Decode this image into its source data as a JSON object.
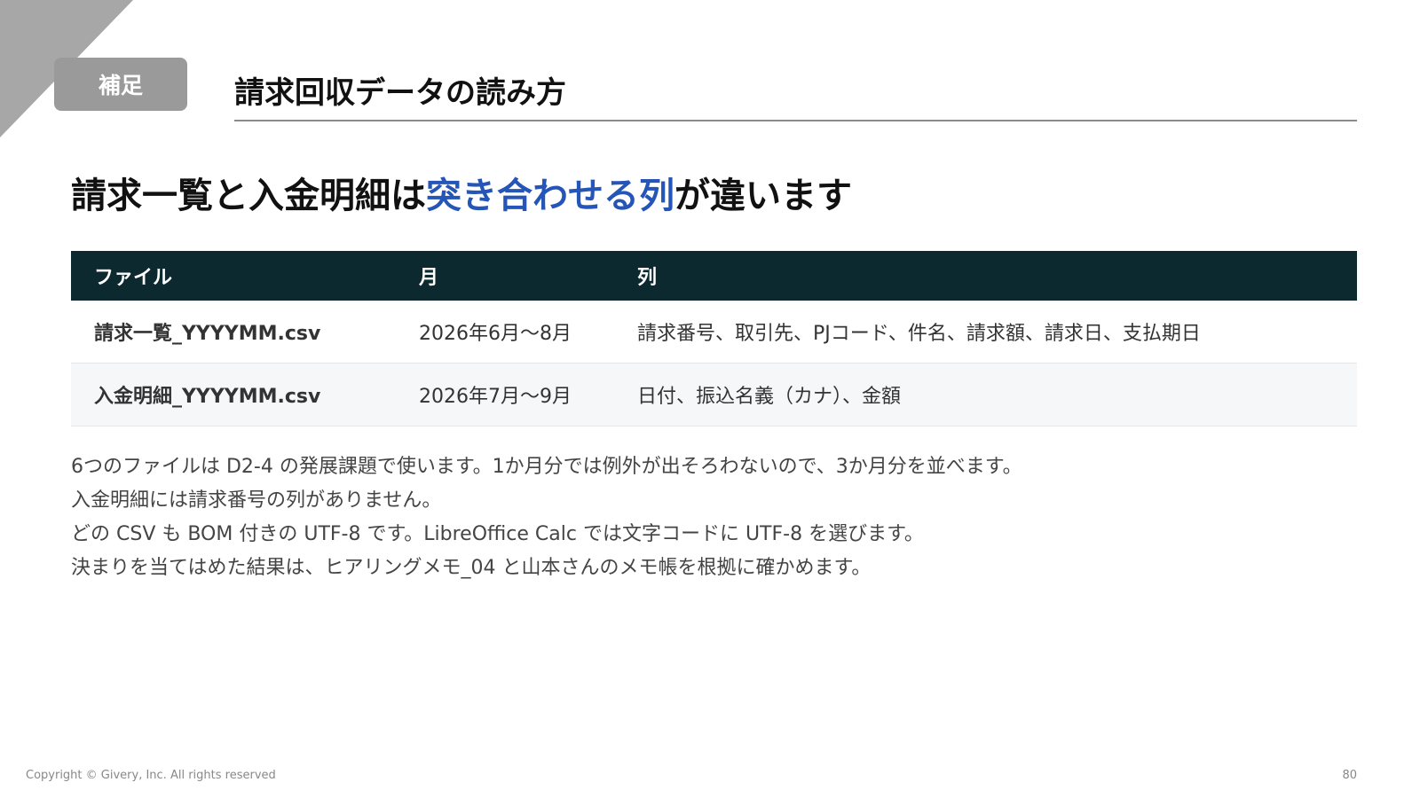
{
  "slide": {
    "tag": "補足",
    "title": "請求回収データの読み方",
    "headline": {
      "before": "請求一覧と入金明細は",
      "highlight": "突き合わせる列",
      "after": "が違います"
    },
    "accent_color": "#2655b8",
    "header_bg_color": "#0d2930"
  },
  "table": {
    "headers": [
      "ファイル",
      "月",
      "列"
    ],
    "rows": [
      [
        "請求一覧_YYYYMM.csv",
        "2026年6月〜8月",
        "請求番号、取引先、PJコード、件名、請求額、請求日、支払期日"
      ],
      [
        "入金明細_YYYYMM.csv",
        "2026年7月〜9月",
        "日付、振込名義（カナ）、金額"
      ]
    ]
  },
  "notes": [
    "6つのファイルは D2-4 の発展課題で使います。1か月分では例外が出そろわないので、3か月分を並べます。",
    "入金明細には請求番号の列がありません。",
    "どの CSV も BOM 付きの UTF-8 です。LibreOffice Calc では文字コードに UTF-8 を選びます。",
    "決まりを当てはめた結果は、ヒアリングメモ_04 と山本さんのメモ帳を根拠に確かめます。"
  ],
  "footer": {
    "copyright": "Copyright © Givery, Inc. All rights reserved",
    "page_number": "80"
  }
}
